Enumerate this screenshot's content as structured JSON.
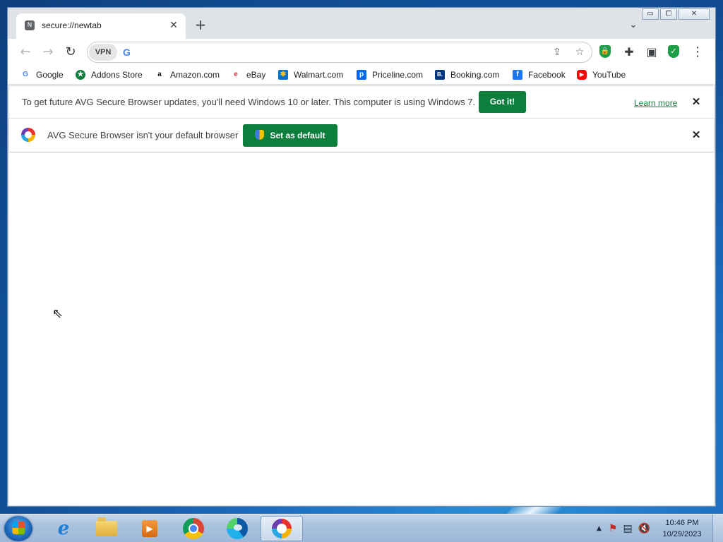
{
  "browser": {
    "tab": {
      "favicon": "N",
      "title": "secure://newtab",
      "close": "✕"
    },
    "new_tab": "+",
    "tab_search": "⌄",
    "window_controls": {
      "minimize": "▭",
      "maximize": "⧠",
      "close": "✕"
    },
    "toolbar": {
      "back": "←",
      "forward": "→",
      "reload": "↻",
      "vpn_label": "VPN",
      "search_engine_icon": "G",
      "address_value": "",
      "address_placeholder": "",
      "share": "⇪",
      "bookmark_star": "☆",
      "extensions": "✚",
      "sidepanel": "▣",
      "menu": "⋮"
    },
    "bookmarks": [
      {
        "label": "Google",
        "icon": "G",
        "color": "#4285f4"
      },
      {
        "label": "Addons Store",
        "icon": "★",
        "color": "#0c7f3d"
      },
      {
        "label": "Amazon.com",
        "icon": "a",
        "color": "#111111"
      },
      {
        "label": "eBay",
        "icon": "e",
        "color": "#e53238"
      },
      {
        "label": "Walmart.com",
        "icon": "✱",
        "color": "#0071ce"
      },
      {
        "label": "Priceline.com",
        "icon": "p",
        "color": "#0068ef"
      },
      {
        "label": "Booking.com",
        "icon": "B.",
        "color": "#003580"
      },
      {
        "label": "Facebook",
        "icon": "f",
        "color": "#1877f2"
      },
      {
        "label": "YouTube",
        "icon": "▶",
        "color": "#ff0000"
      }
    ],
    "infobar_update": {
      "message": "To get future AVG Secure Browser updates, you'll need Windows 10 or later. This computer is using Windows 7.",
      "button": "Got it!",
      "link": "Learn more",
      "close": "✕"
    },
    "infobar_default": {
      "message": "AVG Secure Browser isn't your default browser",
      "button": "Set as default",
      "close": "✕"
    }
  },
  "taskbar": {
    "clock_time": "10:46 PM",
    "clock_date": "10/29/2023",
    "tray_arrow": "▲",
    "apps": [
      {
        "name": "internet-explorer",
        "active": false
      },
      {
        "name": "file-explorer",
        "active": false
      },
      {
        "name": "media-player",
        "active": false
      },
      {
        "name": "chrome",
        "active": false
      },
      {
        "name": "edge",
        "active": false
      },
      {
        "name": "avg-secure-browser",
        "active": true
      }
    ]
  }
}
